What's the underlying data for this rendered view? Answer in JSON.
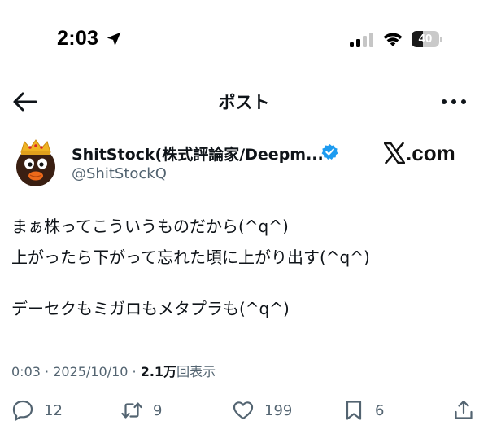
{
  "status_bar": {
    "time": "2:03",
    "battery_level": "40",
    "battery_fraction": 0.4
  },
  "header": {
    "title": "ポスト"
  },
  "post": {
    "author_name": "ShitStock(株式評論家/Deepm...",
    "author_handle": "@ShitStockQ",
    "watermark": "com",
    "lines": [
      "まぁ株ってこういうものだから(^q^)",
      "上がったら下がって忘れた頃に上がり出す(^q^)",
      "デーセクもミガロもメタプラも(^q^)"
    ],
    "time": "0:03",
    "separator": "·",
    "date": "2025/10/10",
    "views_count": "2.1万",
    "views_label": "回表示"
  },
  "actions": {
    "replies": "12",
    "reposts": "9",
    "likes": "199",
    "bookmarks": "6"
  },
  "colors": {
    "text_primary": "#0f1419",
    "text_secondary": "#536471",
    "verified": "#1d9bf0"
  },
  "icons": [
    "location-arrow-icon",
    "cellular-signal-icon",
    "wifi-icon",
    "battery-icon",
    "back-arrow-icon",
    "more-dots-icon",
    "verified-badge-icon",
    "x-logo-icon",
    "reply-icon",
    "repost-icon",
    "like-icon",
    "bookmark-icon",
    "share-icon"
  ]
}
